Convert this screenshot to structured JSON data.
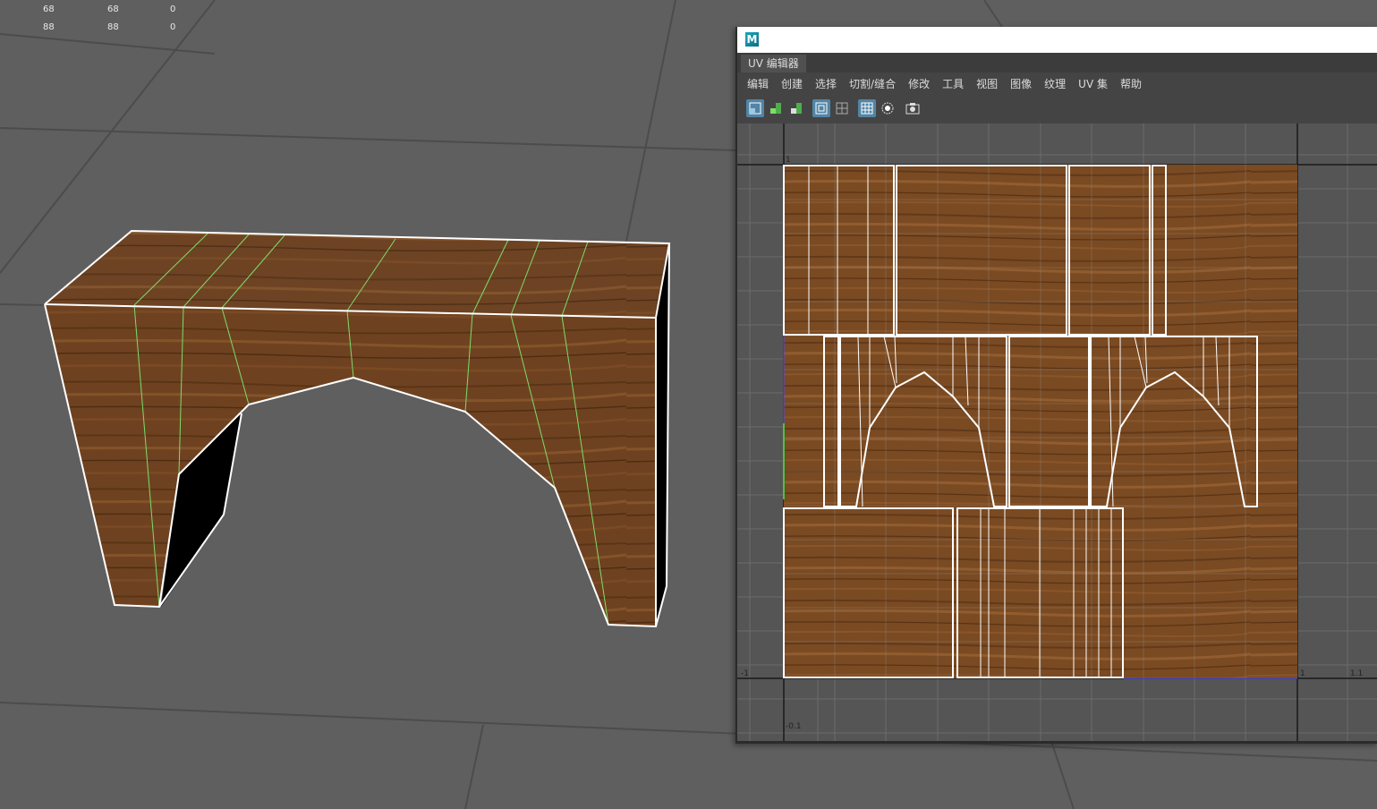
{
  "hud_stats": {
    "rows": [
      [
        "68",
        "68",
        "0"
      ],
      [
        "88",
        "88",
        "0"
      ]
    ]
  },
  "uv_editor": {
    "tab_label": "UV 编辑器",
    "menu": [
      "编辑",
      "创建",
      "选择",
      "切割/缝合",
      "修改",
      "工具",
      "视图",
      "图像",
      "纹理",
      "UV 集",
      "帮助"
    ],
    "toolbar_icons": [
      "uv-shell-icon",
      "uv-stack-icon",
      "uv-unstack-icon",
      "wireframe-toggle-icon",
      "texture-border-icon",
      "grid-toggle-icon",
      "shaded-display-icon",
      "snapshot-icon"
    ],
    "axis_labels": {
      "top_left": "1",
      "left_bottom": "-1",
      "bottom_left": "-0.1",
      "right_one": "1",
      "right_far": "1.1"
    }
  },
  "colors": {
    "viewport_bg": "#5f5f5f",
    "wood": "#6b3f1e",
    "wire_white": "#ffffff",
    "wire_green": "#7fdc6a",
    "accent_blue": "#5285a6"
  }
}
